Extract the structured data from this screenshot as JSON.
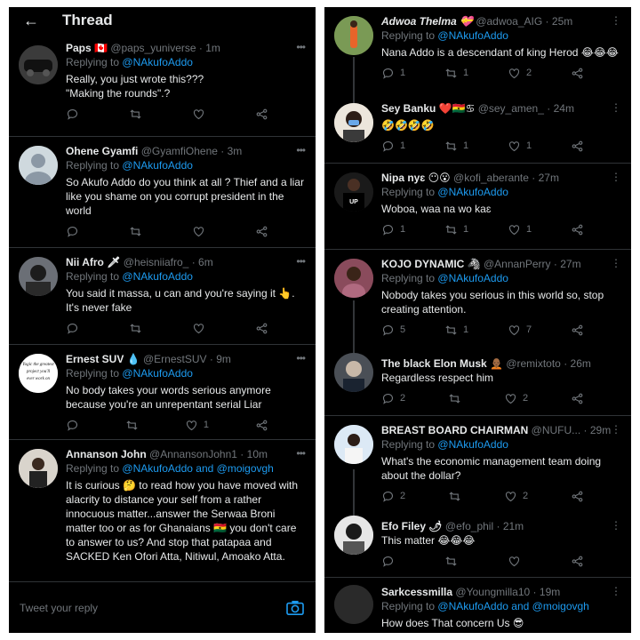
{
  "left": {
    "header": {
      "back_icon": "arrow-left-icon",
      "title": "Thread"
    },
    "replies": [
      {
        "name": "Paps 🇨🇦",
        "handle": "@paps_yuniverse",
        "time": "1m",
        "replying": "Replying to",
        "to": "@NAkufoAddo",
        "text": "Really, you just wrote this???\n\"Making the rounds\".?",
        "reply_count": "",
        "retweet_count": "",
        "like_count": ""
      },
      {
        "name": "Ohene Gyamfi",
        "handle": "@GyamfiOhene",
        "time": "3m",
        "replying": "Replying to",
        "to": "@NAkufoAddo",
        "text": "So Akufo Addo do you think at all  ? Thief and a liar like you shame on you corrupt president in the world",
        "reply_count": "",
        "retweet_count": "",
        "like_count": ""
      },
      {
        "name": "Nii Afro 🗡",
        "handle": "@heisniiafro_",
        "time": "6m",
        "replying": "Replying to",
        "to": "@NAkufoAddo",
        "text": "You said it massa, u can and you're saying it 👆.\nIt's never fake",
        "reply_count": "",
        "retweet_count": "",
        "like_count": ""
      },
      {
        "name": "Ernest SUV 💧",
        "handle": "@ErnestSUV",
        "time": "9m",
        "replying": "Replying to",
        "to": "@NAkufoAddo",
        "text": "No body takes your words serious anymore because you're an unrepentant serial Liar",
        "reply_count": "",
        "retweet_count": "",
        "like_count": "1"
      },
      {
        "name": "Annanson John",
        "handle": "@AnnansonJohn1",
        "time": "10m",
        "replying": "Replying to",
        "to": "@NAkufoAddo and @moigovgh",
        "text": "It is curious 🤔 to read how you have moved with alacrity to distance your self from a rather innocuous matter...answer the Serwaa Broni matter too or as for Ghanaians 🇬🇭 you don't care to answer to us? And stop that patapaa and SACKED Ken Ofori Atta, Nitiwul, Amoako Atta.",
        "reply_count": "",
        "retweet_count": "",
        "like_count": ""
      }
    ],
    "reply_bar": {
      "placeholder": "Tweet your reply",
      "camera_icon": "camera-icon"
    },
    "avatar_note": "Yogic the greatest project you'll ever work on"
  },
  "right": {
    "replies": [
      {
        "name": "Adwoa Thelma 💝",
        "handle": "@adwoa_AIG",
        "time": "25m",
        "replying": "Replying to",
        "to": "@NAkufoAddo",
        "text": "Nana Addo is a descendant of king Herod 😂😂😂",
        "reply_count": "1",
        "retweet_count": "1",
        "like_count": "2"
      },
      {
        "name": "Sey Banku ❤️🇬🇭♋",
        "handle": "@sey_amen_",
        "time": "24m",
        "replying": "",
        "to": "",
        "text": "🤣🤣🤣🤣",
        "reply_count": "1",
        "retweet_count": "1",
        "like_count": "1"
      },
      {
        "name": "Nipa nyɛ 😶😮",
        "handle": "@kofi_aberante",
        "time": "27m",
        "replying": "Replying to",
        "to": "@NAkufoAddo",
        "text": "Woboa, waa na wo kaɛ",
        "reply_count": "1",
        "retweet_count": "1",
        "like_count": "1"
      },
      {
        "name": "KOJO DYNAMIC 🦓",
        "handle": "@AnnanPerry",
        "time": "27m",
        "replying": "Replying to",
        "to": "@NAkufoAddo",
        "text": "Nobody takes you serious in this world so, stop creating attention.",
        "reply_count": "5",
        "retweet_count": "1",
        "like_count": "7"
      },
      {
        "name": "The black Elon Musk 🧑🏾‍🦲",
        "handle": "@remixtoto",
        "time": "26m",
        "replying": "",
        "to": "",
        "text": "Regardless respect him",
        "reply_count": "2",
        "retweet_count": "",
        "like_count": "2"
      },
      {
        "name": "BREAST BOARD CHAIRMAN",
        "handle": "@NUFU...",
        "time": "29m",
        "replying": "Replying to",
        "to": "@NAkufoAddo",
        "text": "What's the economic management team doing about the dollar?",
        "reply_count": "2",
        "retweet_count": "",
        "like_count": "2"
      },
      {
        "name": "Efo Filey 🌶",
        "handle": "@efo_phil",
        "time": "21m",
        "replying": "",
        "to": "",
        "text": "This matter 😂😂😂",
        "reply_count": "",
        "retweet_count": "",
        "like_count": ""
      },
      {
        "name": "Sarkcessmilla",
        "handle": "@Youngmilla10",
        "time": "19m",
        "replying": "Replying to",
        "to": "@NAkufoAddo and @moigovgh",
        "text": "How does That concern Us 😎",
        "reply_count": "",
        "retweet_count": "",
        "like_count": ""
      }
    ]
  },
  "icons": {
    "reply": "reply-icon",
    "retweet": "retweet-icon",
    "like": "heart-icon",
    "share": "share-icon",
    "more": "more-icon"
  },
  "colors": {
    "background": "#000000",
    "link": "#1d9bf0",
    "text": "#e7e9ea",
    "muted": "#71767b",
    "divider": "#2f3336"
  }
}
